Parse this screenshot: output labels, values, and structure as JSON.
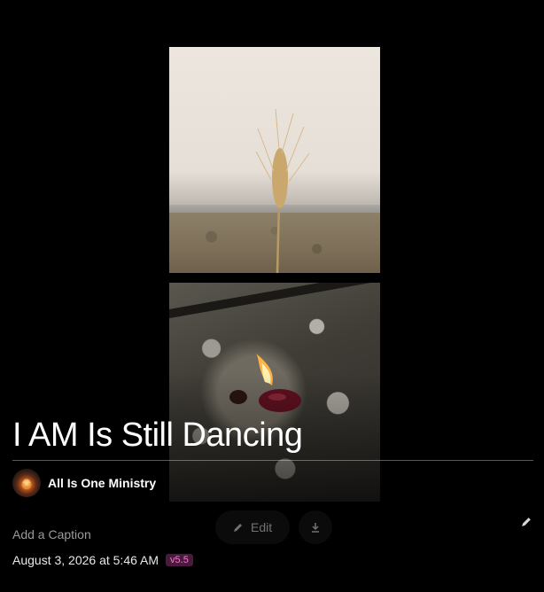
{
  "post": {
    "title": "I AM Is Still Dancing",
    "author_name": "All Is One Ministry",
    "caption_placeholder": "Add a Caption",
    "timestamp": "August 3, 2026 at 5:46 AM",
    "version": "v5.5"
  },
  "toolbar": {
    "edit_label": "Edit"
  },
  "icons": {
    "edit": "pencil-icon",
    "download": "download-icon",
    "caption_edit": "pencil-icon"
  },
  "colors": {
    "background": "#000000",
    "badge_bg": "#4a1a3e",
    "badge_text": "#f27ad1"
  }
}
